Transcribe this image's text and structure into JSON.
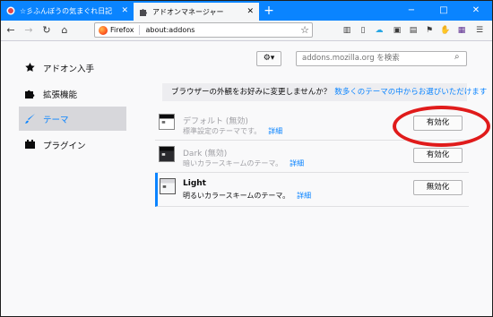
{
  "tabs": [
    {
      "label": "☆彡ふんぼうの気まぐれ日記",
      "active": false
    },
    {
      "label": "アドオンマネージャー",
      "active": true
    }
  ],
  "window_controls": {
    "minimize": "−",
    "maximize": "□",
    "close": "✕"
  },
  "urlbar": {
    "browser_label": "Firefox",
    "url": "about:addons"
  },
  "sidebar": {
    "items": [
      {
        "label": "アドオン入手",
        "selected": false
      },
      {
        "label": "拡張機能",
        "selected": false
      },
      {
        "label": "テーマ",
        "selected": true
      },
      {
        "label": "プラグイン",
        "selected": false
      }
    ]
  },
  "toolbar": {
    "gear_label": "⚙▾"
  },
  "search": {
    "placeholder": "addons.mozilla.org を検索"
  },
  "banner": {
    "text": "ブラウザーの外観をお好みに変更しませんか？",
    "link": "数多くのテーマの中からお選びいただけます"
  },
  "themes": [
    {
      "name": "デフォルト (無効)",
      "description": "標準設定のテーマです。",
      "more": "詳細",
      "button": "有効化",
      "enabled": false
    },
    {
      "name": "Dark (無効)",
      "description": "暗いカラースキームのテーマ。",
      "more": "詳細",
      "button": "有効化",
      "enabled": false
    },
    {
      "name": "Light",
      "description": "明るいカラースキームのテーマ。",
      "more": "詳細",
      "button": "無効化",
      "enabled": true
    }
  ],
  "colors": {
    "accent": "#0a84ff",
    "annotation": "#e01b1b"
  }
}
